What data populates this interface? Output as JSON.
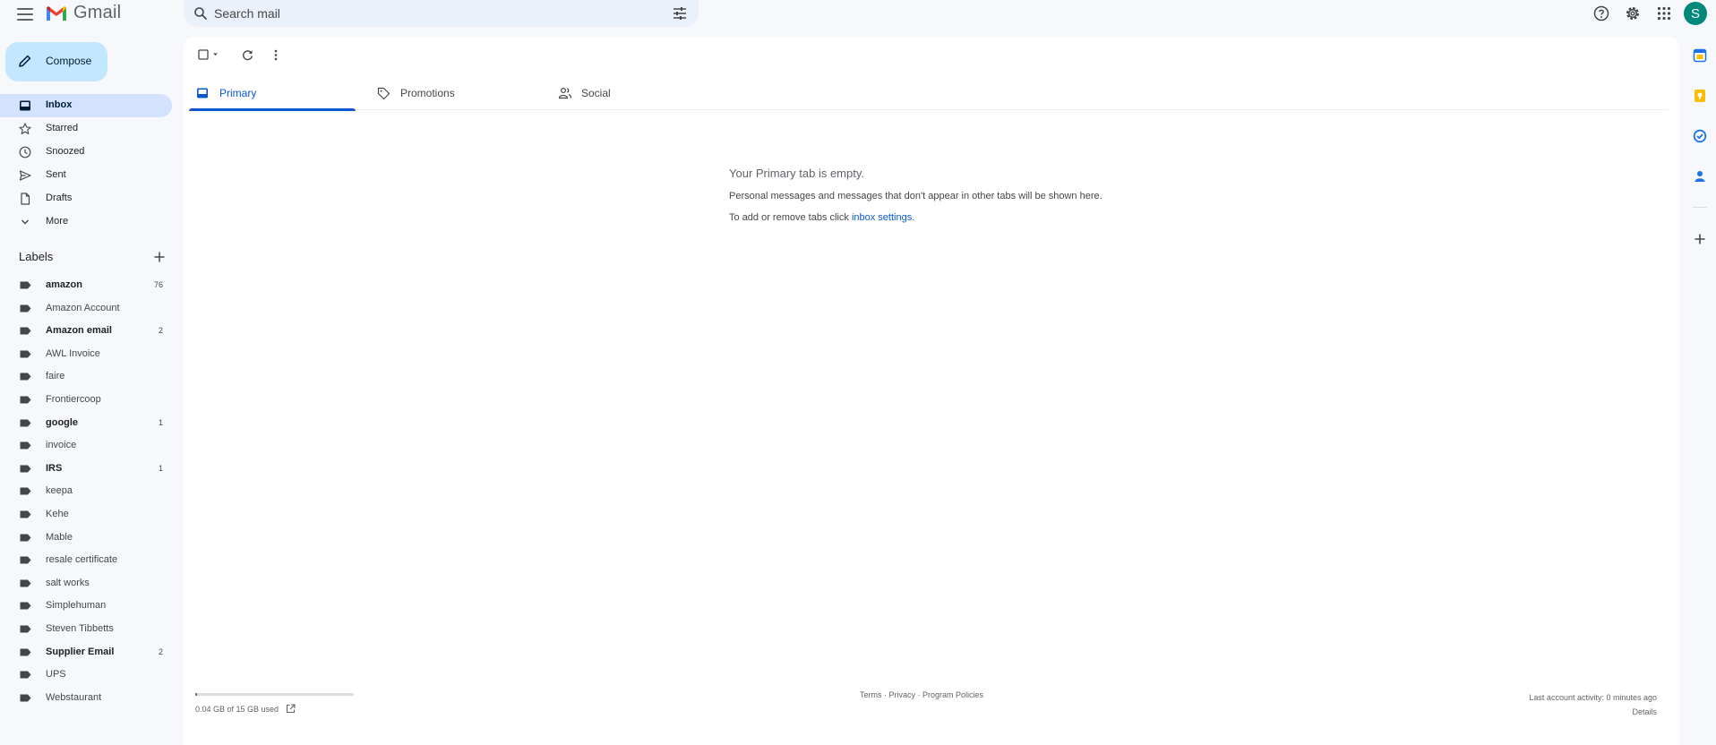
{
  "app": {
    "name": "Gmail"
  },
  "search": {
    "placeholder": "Search mail"
  },
  "compose": {
    "label": "Compose"
  },
  "nav": [
    {
      "label": "Inbox",
      "icon": "inbox-icon",
      "active": true
    },
    {
      "label": "Starred",
      "icon": "star-icon"
    },
    {
      "label": "Snoozed",
      "icon": "clock-icon"
    },
    {
      "label": "Sent",
      "icon": "send-icon"
    },
    {
      "label": "Drafts",
      "icon": "draft-icon"
    },
    {
      "label": "More",
      "icon": "chevron-down-icon"
    }
  ],
  "labels_heading": "Labels",
  "labels": [
    {
      "name": "amazon",
      "count": "76",
      "bold": true
    },
    {
      "name": "Amazon Account",
      "count": "",
      "bold": false
    },
    {
      "name": "Amazon email",
      "count": "2",
      "bold": true
    },
    {
      "name": "AWL Invoice",
      "count": "",
      "bold": false
    },
    {
      "name": "faire",
      "count": "",
      "bold": false
    },
    {
      "name": "Frontiercoop",
      "count": "",
      "bold": false
    },
    {
      "name": "google",
      "count": "1",
      "bold": true
    },
    {
      "name": "invoice",
      "count": "",
      "bold": false
    },
    {
      "name": "IRS",
      "count": "1",
      "bold": true
    },
    {
      "name": "keepa",
      "count": "",
      "bold": false
    },
    {
      "name": "Kehe",
      "count": "",
      "bold": false
    },
    {
      "name": "Mable",
      "count": "",
      "bold": false
    },
    {
      "name": "resale certificate",
      "count": "",
      "bold": false
    },
    {
      "name": "salt works",
      "count": "",
      "bold": false
    },
    {
      "name": "Simplehuman",
      "count": "",
      "bold": false
    },
    {
      "name": "Steven Tibbetts",
      "count": "",
      "bold": false
    },
    {
      "name": "Supplier Email",
      "count": "2",
      "bold": true
    },
    {
      "name": "UPS",
      "count": "",
      "bold": false
    },
    {
      "name": "Webstaurant",
      "count": "",
      "bold": false
    }
  ],
  "tabs": [
    {
      "label": "Primary",
      "icon": "inbox-icon",
      "active": true
    },
    {
      "label": "Promotions",
      "icon": "tag-icon"
    },
    {
      "label": "Social",
      "icon": "people-icon"
    }
  ],
  "empty": {
    "title": "Your Primary tab is empty.",
    "message": "Personal messages and messages that don't appear in other tabs will be shown here.",
    "settings_prefix": "To add or remove tabs click ",
    "settings_link": "inbox settings",
    "settings_suffix": "."
  },
  "footer": {
    "storage": "0.04 GB of 15 GB used",
    "storage_fraction": 0.003,
    "terms": "Terms",
    "privacy": "Privacy",
    "program_policies": "Program Policies",
    "separator": " · ",
    "activity": "Last account activity: 0 minutes ago",
    "details": "Details"
  },
  "account": {
    "initial": "S",
    "color": "#00897b"
  },
  "colors": {
    "accent": "#0b57d0",
    "compose_bg": "#c2e7ff",
    "active_nav": "#d3e3fd"
  }
}
